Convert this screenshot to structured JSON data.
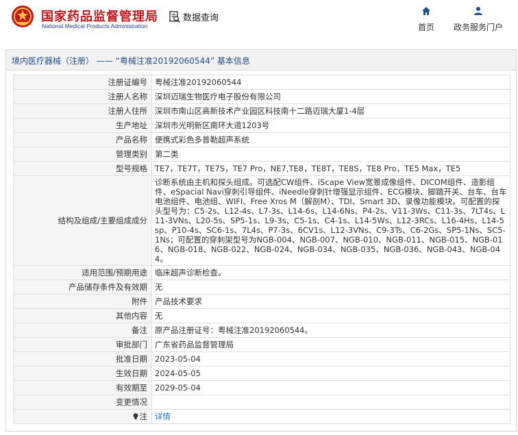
{
  "header": {
    "site_title": "国家药品监督管理局",
    "site_subtitle": "National Medical Products Administration",
    "query_label": "数据查询",
    "nav": [
      {
        "label": "首页",
        "icon": "home-icon"
      },
      {
        "label": "政务服务门户",
        "icon": "user-icon"
      }
    ]
  },
  "panel": {
    "title": "境内医疗器械（注册） —— “粤械注准20192060544” 基本信息"
  },
  "rows": [
    {
      "label": "注册证编号",
      "value": "粤械注准20192060544"
    },
    {
      "label": "注册人名称",
      "value": "深圳迈瑞生物医疗电子股份有限公司"
    },
    {
      "label": "注册人住所",
      "value": "深圳市南山区高新技术产业园区科技南十二路迈瑞大厦1-4层"
    },
    {
      "label": "生产地址",
      "value": "深圳市光明新区南环大道1203号"
    },
    {
      "label": "产品名称",
      "value": "便携式彩色多普勒超声系统"
    },
    {
      "label": "管理类别",
      "value": "第二类"
    },
    {
      "label": "型号规格",
      "value": "TE7，TE7T，TE7S，TE7 Pro，NE7,TE8，TE8T，TE8S，TE8 Pro，TE5 Max，TE5"
    },
    {
      "label": "结构及组成/主要组成成分",
      "value": "诊断系统由主机和探头组成。可选配CW组件、iScape View宽景成像组件、DICOM组件、造影组件、eSpacial Navi穿刺引导组件、iNeedle穿刺针增强显示组件、ECG模块、脚踏开关、台车、台车电池组件、电池组、WIFI、Free Xros M（解剖M）、TDI、Smart 3D、录像功能模块。可配置的探头型号为：C5-2s、L12-4s、L7-3s、L14-6s、L14-6Ns、P4-2s、V11-3Ws、C11-3s、7LT4s、L11-3VNs、L20-5s、SP5-1s、L9-3s、C5-1s、C4-1s、L14-5Ws、L12-3RCs、L16-4Hs、L14-5sp、P10-4s、SC6-1s、7L4s、P7-3s、6CV1s、L12-3VNs、C9-3Ts、C6-2Gs、SP5-1Ns、SC5-1Ns；可配置的穿刺架型号为NGB-004、NGB-007、NGB-010、NGB-011、NGB-015、NGB-016、NGB-018、NGB-022、NGB-024、NGB-034、NGB-035、NGB-036、NGB-043、NGB-044。"
    },
    {
      "label": "适用范围/预期用途",
      "value": "临床超声诊断检查。"
    },
    {
      "label": "产品储存条件及有效期",
      "value": "无"
    },
    {
      "label": "附件",
      "value": "产品技术要求"
    },
    {
      "label": "其他内容",
      "value": "无"
    },
    {
      "label": "备注",
      "value": "原产品注册证号：粤械注准20192060544。"
    },
    {
      "label": "审批部门",
      "value": "广东省药品监督管理局"
    },
    {
      "label": "批准日期",
      "value": "2023-05-04"
    },
    {
      "label": "生效日期",
      "value": "2024-05-05"
    },
    {
      "label": "有效期至",
      "value": "2029-05-04"
    },
    {
      "label": "变更情况",
      "value": ""
    },
    {
      "label": "注",
      "value": "详情",
      "icon": "lightbulb-icon"
    }
  ],
  "colors": {
    "brand_red": "#c4161c",
    "link_blue": "#1e6fcf",
    "nav_blue": "#1f4e8c"
  }
}
